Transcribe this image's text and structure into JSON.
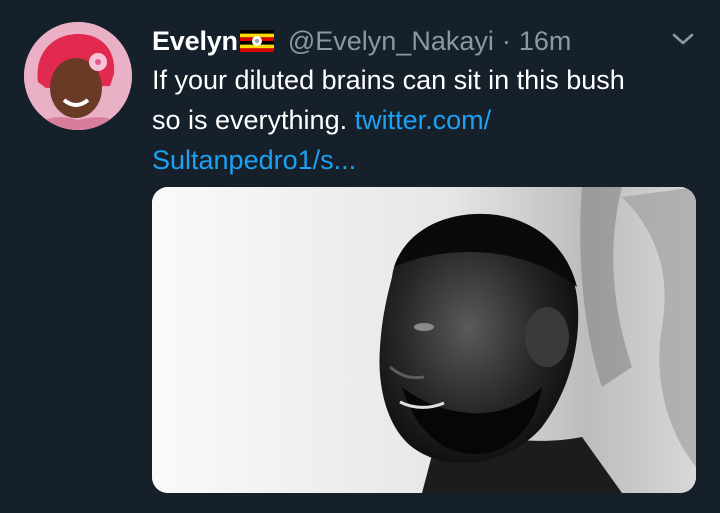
{
  "tweet": {
    "display_name": "Evelyn",
    "flag_icon": "uganda-flag-icon",
    "handle": "@Evelyn_Nakayi",
    "separator": "·",
    "time": "16m",
    "text_line1": "If your diluted brains can sit in this bush",
    "text_line2": "so is everything.",
    "link_part1": "twitter.com/",
    "link_part2": "Sultanpedro1/s...",
    "menu_icon": "chevron-down-icon",
    "avatar_icon": "profile-avatar",
    "media_icon": "photo-black-and-white-portrait"
  },
  "colors": {
    "background": "#15202b",
    "name": "#ffffff",
    "secondary": "#8899a6",
    "link": "#1da1f2"
  }
}
